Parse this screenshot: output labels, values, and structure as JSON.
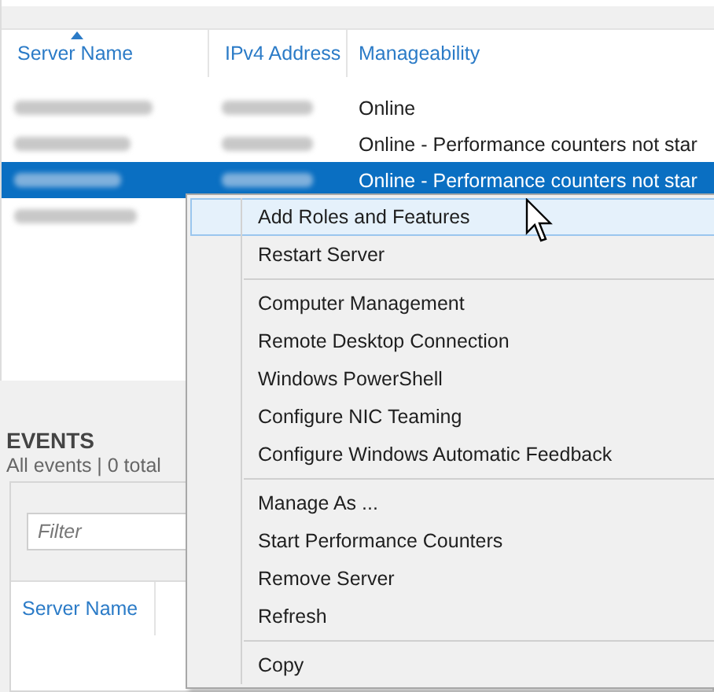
{
  "servers": {
    "columns": [
      {
        "label": "Server Name",
        "sorted": true
      },
      {
        "label": "IPv4 Address",
        "sorted": false
      },
      {
        "label": "Manageability",
        "sorted": false
      }
    ],
    "rows": [
      {
        "manageability": "Online",
        "selected": false
      },
      {
        "manageability": "Online - Performance counters not star",
        "selected": false
      },
      {
        "manageability": "Online - Performance counters not star",
        "selected": true
      },
      {
        "selected": false
      }
    ]
  },
  "events": {
    "title": "EVENTS",
    "summary": "All events | 0 total",
    "filter": {
      "placeholder": "Filter"
    },
    "columns": [
      {
        "label": "Server Name"
      }
    ]
  },
  "context_menu": {
    "groups": [
      [
        {
          "label": "Add Roles and Features",
          "selected": true
        },
        {
          "label": "Restart Server",
          "selected": false
        }
      ],
      [
        {
          "label": "Computer Management",
          "selected": false
        },
        {
          "label": "Remote Desktop Connection",
          "selected": false
        },
        {
          "label": "Windows PowerShell",
          "selected": false
        },
        {
          "label": "Configure NIC Teaming",
          "selected": false
        },
        {
          "label": "Configure Windows Automatic Feedback",
          "selected": false
        }
      ],
      [
        {
          "label": "Manage As ...",
          "selected": false
        },
        {
          "label": "Start Performance Counters",
          "selected": false
        },
        {
          "label": "Remove Server",
          "selected": false
        },
        {
          "label": "Refresh",
          "selected": false
        }
      ],
      [
        {
          "label": "Copy",
          "selected": false
        }
      ]
    ]
  }
}
